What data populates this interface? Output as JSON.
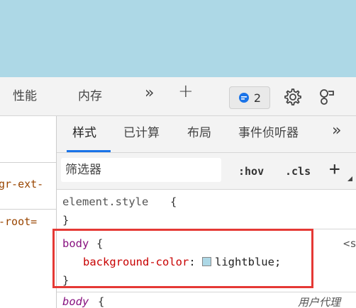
{
  "toolbar": {
    "tabs": [
      "性能",
      "内存"
    ],
    "more_label": "»",
    "add_label": "+",
    "issues_count": "2"
  },
  "elements_panel": {
    "lines": [
      "gr-ext-",
      "-root="
    ]
  },
  "styles_tabs": {
    "items": [
      "样式",
      "已计算",
      "布局",
      "事件侦听器"
    ],
    "more_label": "»"
  },
  "filter": {
    "placeholder": "筛选器",
    "hov_label": ":hov",
    "cls_label": ".cls",
    "add_label": "+"
  },
  "rules": {
    "element_style": {
      "selector": "element.style",
      "open": "{",
      "close": "}"
    },
    "body_rule": {
      "selector": "body",
      "open": "{",
      "close": "}",
      "source": "<s",
      "property": "background-color",
      "value": "lightblue",
      "swatch_color": "#add8e6"
    },
    "body_ua": {
      "selector": "body",
      "open": "{",
      "source": "用户代理"
    }
  },
  "colors": {
    "page_background": "#add8e6",
    "accent": "#1a73e8",
    "highlight": "#e53935"
  }
}
